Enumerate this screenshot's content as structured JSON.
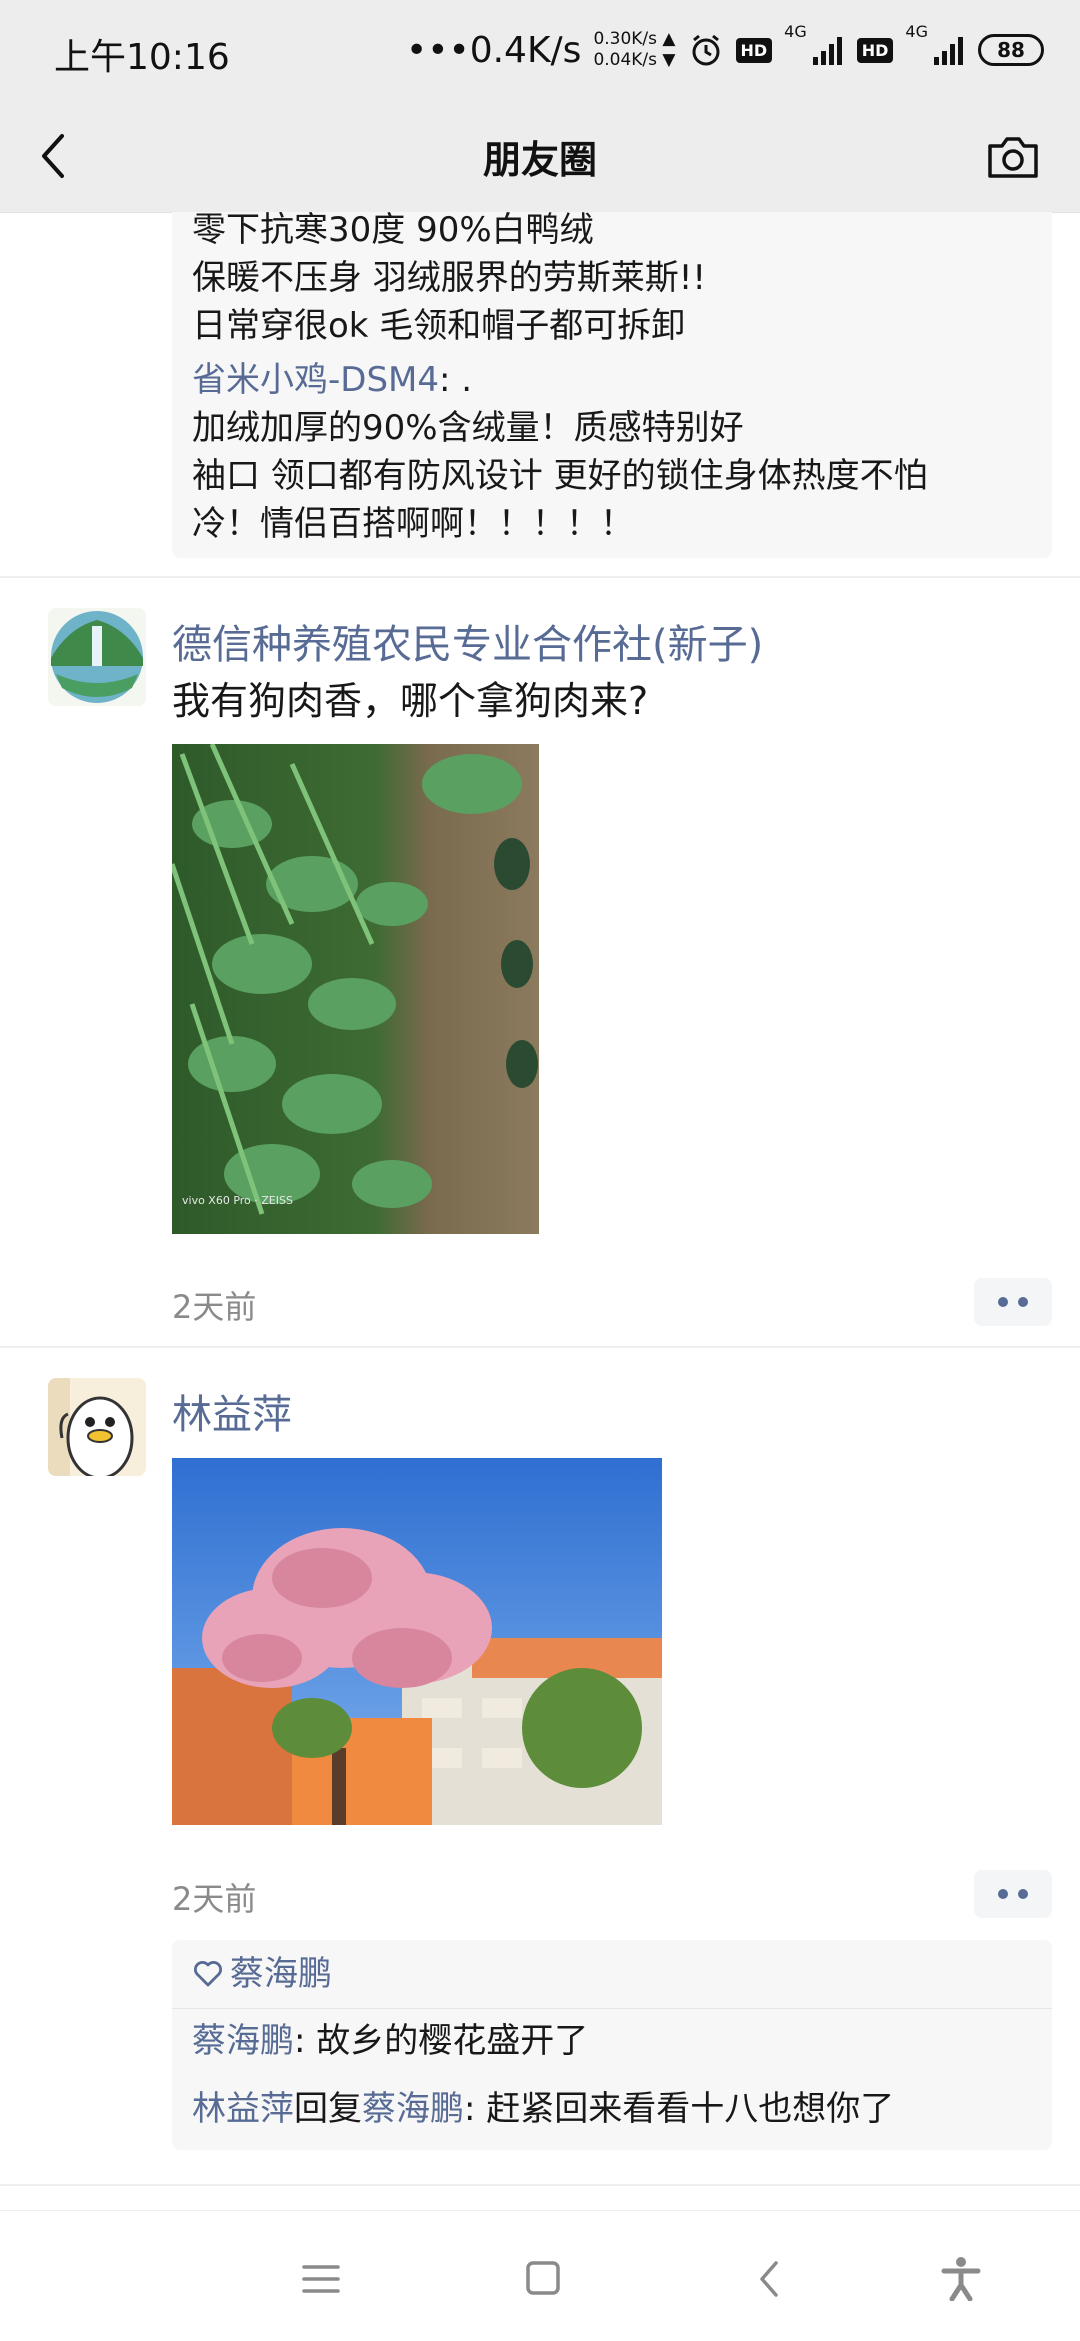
{
  "status_bar": {
    "time": "上午10:16",
    "net_speed": "•••0.4K/s",
    "up_speed": "0.30K/s ▲",
    "down_speed": "0.04K/s ▼",
    "network_1": "4G",
    "network_2": "4G",
    "hd": "HD",
    "battery": "88"
  },
  "navbar": {
    "title": "朋友圈"
  },
  "posts": [
    {
      "comments_partial": [
        {
          "text": "零下抗寒30度 90%白鸭绒"
        },
        {
          "text": "保暖不压身 羽绒服界的劳斯莱斯!!"
        },
        {
          "text": "日常穿很ok 毛领和帽子都可拆卸"
        },
        {
          "name": "省米小鸡-DSM4",
          "sep": ": .",
          "text": ""
        },
        {
          "text": "加绒加厚的90%含绒量！质感特别好"
        },
        {
          "text": "袖口 领口都有防风设计 更好的锁住身体热度不怕"
        },
        {
          "text": "冷！情侣百搭啊啊！！！！！"
        }
      ]
    },
    {
      "author": "德信种养殖农民专业合作社(新子)",
      "text": "我有狗肉香，哪个拿狗肉来?",
      "image_watermark": "vivo X60 Pro · ZEISS",
      "time": "2天前"
    },
    {
      "author": "林益萍",
      "time": "2天前",
      "likes": "蔡海鹏",
      "comments": [
        {
          "name": "蔡海鹏",
          "sep": ": ",
          "text": "故乡的樱花盛开了"
        },
        {
          "name": "林益萍",
          "reply_word": "回复",
          "reply_to": "蔡海鹏",
          "sep": ": ",
          "text": "赶紧回来看看十八也想你了"
        }
      ]
    }
  ],
  "colors": {
    "link_blue": "#576b95",
    "bar_gray": "#ededed"
  }
}
